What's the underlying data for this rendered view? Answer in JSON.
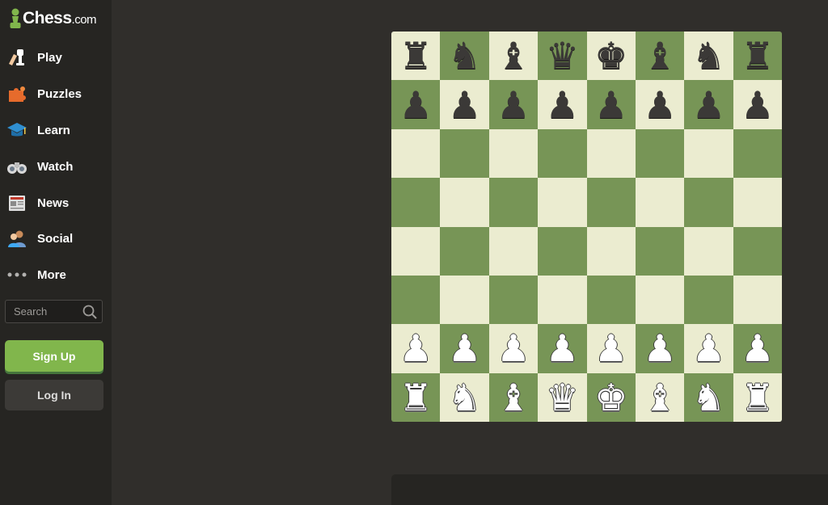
{
  "logo": {
    "name": "Chess",
    "suffix": ".com"
  },
  "nav": [
    {
      "label": "Play",
      "icon": "play-hand-icon"
    },
    {
      "label": "Puzzles",
      "icon": "puzzle-piece-icon"
    },
    {
      "label": "Learn",
      "icon": "graduation-cap-icon"
    },
    {
      "label": "Watch",
      "icon": "binoculars-icon"
    },
    {
      "label": "News",
      "icon": "newspaper-icon"
    },
    {
      "label": "Social",
      "icon": "people-icon"
    },
    {
      "label": "More",
      "icon": "more-dots-icon"
    }
  ],
  "search": {
    "placeholder": "Search",
    "value": ""
  },
  "buttons": {
    "signup": "Sign Up",
    "login": "Log In"
  },
  "colors": {
    "accent": "#81b64c",
    "board_light": "#ebecd0",
    "board_dark": "#779556",
    "sidebar": "#262522",
    "background": "#302e2b"
  },
  "board": {
    "rows": [
      [
        "♜",
        "♞",
        "♝",
        "♛",
        "♚",
        "♝",
        "♞",
        "♜"
      ],
      [
        "♟",
        "♟",
        "♟",
        "♟",
        "♟",
        "♟",
        "♟",
        "♟"
      ],
      [
        "",
        "",
        "",
        "",
        "",
        "",
        "",
        ""
      ],
      [
        "",
        "",
        "",
        "",
        "",
        "",
        "",
        ""
      ],
      [
        "",
        "",
        "",
        "",
        "",
        "",
        "",
        ""
      ],
      [
        "",
        "",
        "",
        "",
        "",
        "",
        "",
        ""
      ],
      [
        "♙",
        "♙",
        "♙",
        "♙",
        "♙",
        "♙",
        "♙",
        "♙"
      ],
      [
        "♖",
        "♘",
        "♗",
        "♕",
        "♔",
        "♗",
        "♘",
        "♖"
      ]
    ]
  }
}
